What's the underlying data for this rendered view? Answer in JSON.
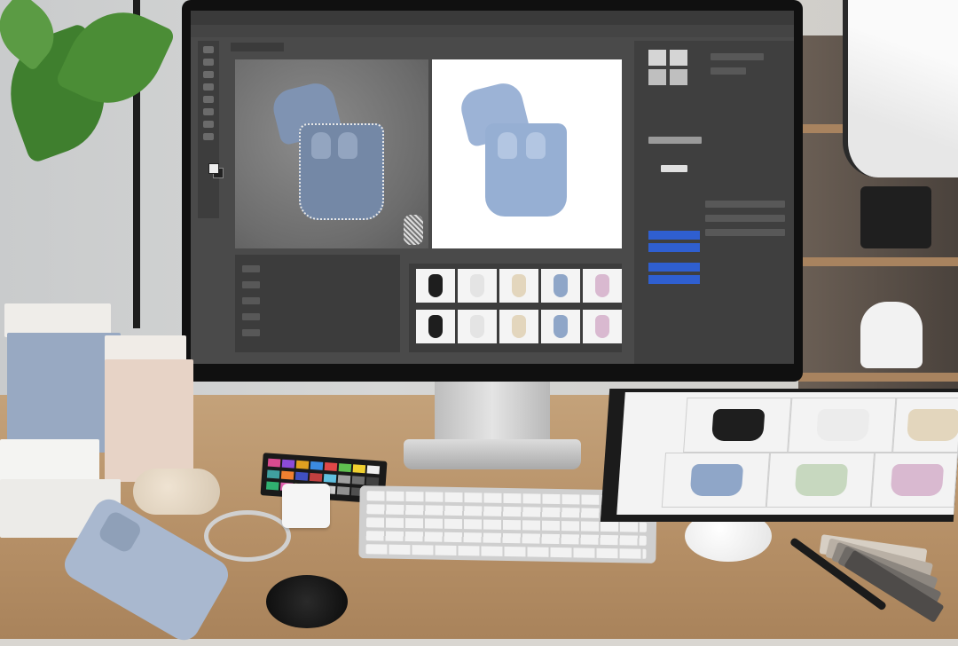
{
  "scene": {
    "description_icons": [
      "monitor",
      "keyboard",
      "mouse",
      "phone",
      "color-checker",
      "lens-cap",
      "charger",
      "usb-cable",
      "product-binder",
      "swatch-fan-deck",
      "pen",
      "product-boxes"
    ]
  },
  "photo_editor": {
    "menu_items": [
      "",
      "",
      "",
      "",
      "",
      "",
      "",
      "",
      "",
      ""
    ],
    "document_tab": "",
    "panel_buttons": [
      "",
      "",
      "",
      ""
    ]
  },
  "palette": {
    "case_blue": "#8fa6c8",
    "case_black": "#1e1e1e",
    "case_white": "#ececec",
    "case_beige": "#e3d6bd",
    "case_green": "#c7d8bf",
    "case_pink": "#d9b9d0",
    "ps_accent": "#2f5fd0"
  },
  "product_variants": [
    "black",
    "white",
    "beige",
    "blue",
    "green",
    "pink"
  ]
}
